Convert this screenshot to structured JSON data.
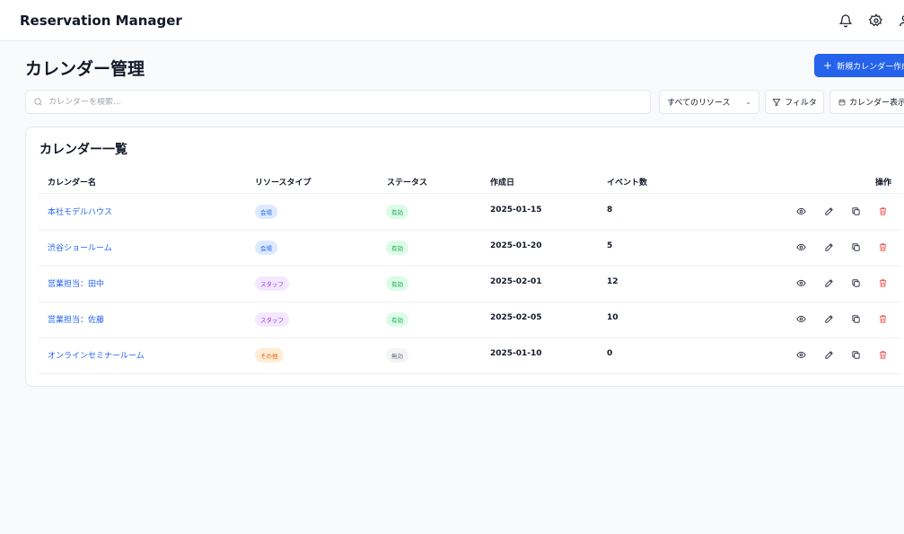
{
  "app": {
    "title": "Reservation Manager"
  },
  "header": {
    "icons": [
      "bell-icon",
      "gear-icon",
      "user-icon"
    ]
  },
  "page": {
    "title": "カレンダー管理",
    "create_button": "新規カレンダー作成"
  },
  "toolbar": {
    "search_placeholder": "カレンダーを検索...",
    "resource_select": "すべてのリソース",
    "filter_label": "フィルタ",
    "calendar_view_label": "カレンダー表示"
  },
  "card": {
    "title": "カレンダー一覧"
  },
  "table": {
    "headers": {
      "name": "カレンダー名",
      "type": "リソースタイプ",
      "status": "ステータス",
      "created": "作成日",
      "events": "イベント数",
      "actions": "操作"
    },
    "rows": [
      {
        "name": "本社モデルハウス",
        "type": "会場",
        "type_kind": "venue",
        "status": "有効",
        "status_kind": "active",
        "created": "2025-01-15",
        "events": "8"
      },
      {
        "name": "渋谷ショールーム",
        "type": "会場",
        "type_kind": "venue",
        "status": "有効",
        "status_kind": "active",
        "created": "2025-01-20",
        "events": "5"
      },
      {
        "name": "営業担当：田中",
        "type": "スタッフ",
        "type_kind": "staff",
        "status": "有効",
        "status_kind": "active",
        "created": "2025-02-01",
        "events": "12"
      },
      {
        "name": "営業担当：佐藤",
        "type": "スタッフ",
        "type_kind": "staff",
        "status": "有効",
        "status_kind": "active",
        "created": "2025-02-05",
        "events": "10"
      },
      {
        "name": "オンラインセミナールーム",
        "type": "その他",
        "type_kind": "other",
        "status": "無効",
        "status_kind": "inactive",
        "created": "2025-01-10",
        "events": "0"
      }
    ]
  },
  "colors": {
    "accent": "#2563eb",
    "danger": "#ef4444",
    "success": "#16a34a"
  }
}
